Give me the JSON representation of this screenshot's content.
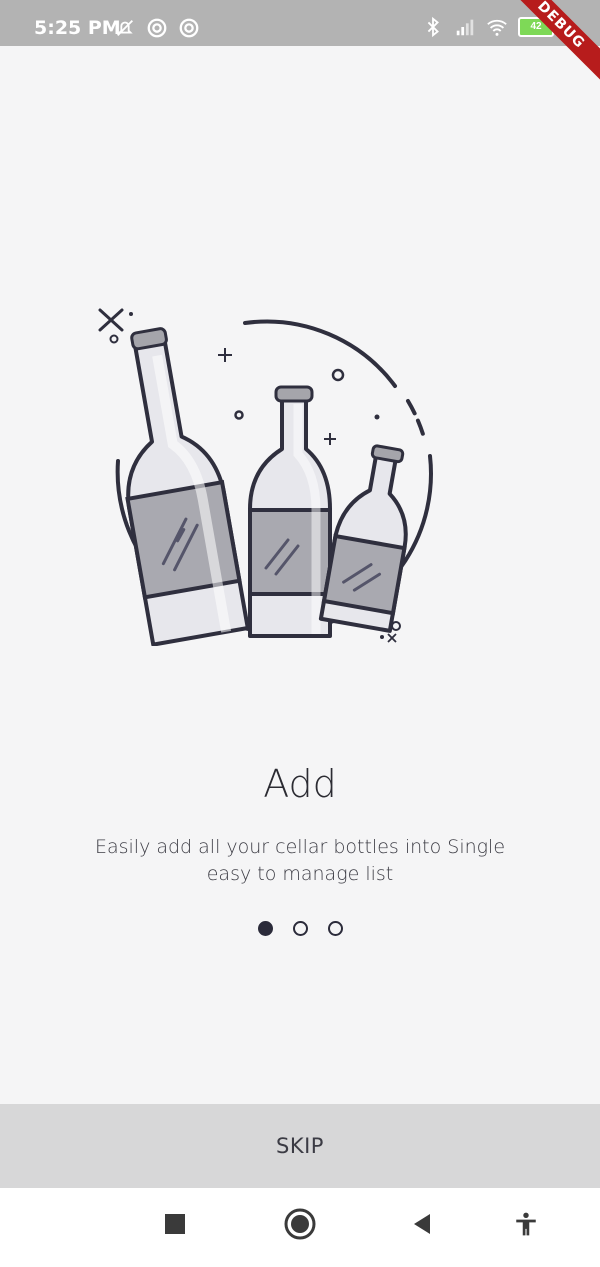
{
  "status_bar": {
    "time": "5:25 PM",
    "battery_level": "42",
    "left_icons": [
      "bell-off-icon",
      "sync-icon",
      "sync-icon"
    ],
    "right_icons": [
      "bluetooth-icon",
      "signal-icon",
      "wifi-icon",
      "battery-icon"
    ],
    "debug_label": "DEBUG"
  },
  "onboarding": {
    "title": "Add",
    "description": "Easily add all your cellar bottles into Single easy to manage list",
    "page_count": 3,
    "active_page": 0
  },
  "skip_button": {
    "label": "SKIP"
  },
  "nav_bar": {
    "icons": [
      "square-icon",
      "home-circle-icon",
      "back-triangle-icon",
      "accessibility-icon"
    ]
  },
  "colors": {
    "background": "#f5f5f6",
    "status_bar": "#b3b3b3",
    "accent_dark": "#2b2b3a",
    "skip_bar": "#d7d7d8",
    "debug_ribbon": "#b71c1c"
  }
}
